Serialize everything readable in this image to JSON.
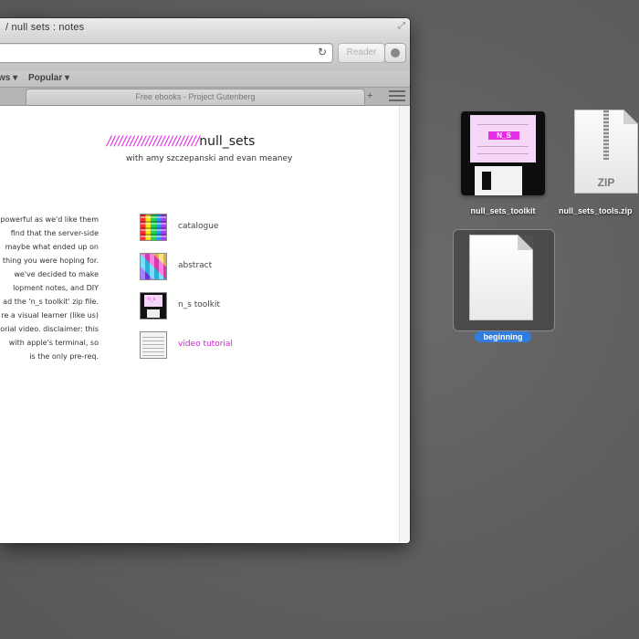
{
  "browser": {
    "window_title": "/ null sets : notes",
    "reader_label": "Reader",
    "bookmarks": [
      "ws ▾",
      "Popular ▾"
    ],
    "tab_title": "Free ebooks - Project Gutenberg",
    "new_tab_symbol": "+"
  },
  "page": {
    "title_slashes": "////////////////////////",
    "title_name": "null_sets",
    "subtitle": "with amy szczepanski and evan meaney",
    "intro_lines": [
      "powerful as we'd like them",
      "find that the server-side",
      "maybe what ended up on",
      "thing you were hoping for.",
      "we've decided to make",
      "lopment notes, and DIY",
      "ad the 'n_s toolkit' zip file.",
      "re a visual learner (like us)",
      "orial video. disclaimer: this",
      "with apple's terminal, so",
      "is the only pre-req."
    ],
    "menu": [
      {
        "label": "catalogue",
        "icon": "catalogue-thumbnail"
      },
      {
        "label": "abstract",
        "icon": "abstract-thumbnail"
      },
      {
        "label": "n_s toolkit",
        "icon": "floppy-disk-thumbnail"
      },
      {
        "label": "video tutorial",
        "icon": "video-thumbnail"
      }
    ],
    "disk_label": "n_s",
    "link_color": "#d81ed8",
    "accent_color": "#e52de6"
  },
  "desktop": {
    "icons": [
      {
        "caption": "null_sets_toolkit",
        "icon": "floppy-disk-icon"
      },
      {
        "caption": "null_sets_tools.zip",
        "icon": "zip-archive-icon",
        "badge": "ZIP"
      },
      {
        "caption": "beginning",
        "icon": "blank-document-icon",
        "selected": true
      }
    ],
    "floppy_label": "N_S",
    "selection_color": "#2f7de0"
  }
}
